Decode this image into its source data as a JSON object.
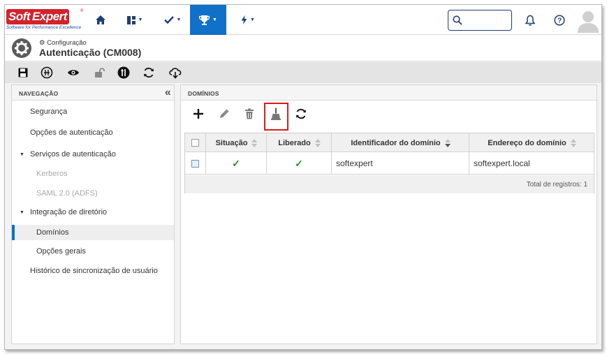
{
  "brand": {
    "soft": "Soft",
    "expert": "Expert",
    "reg": "®",
    "tagline": "Software for Performance Excellence",
    "color": "#d3222a"
  },
  "topnav": {
    "items": [
      {
        "icon": "home-icon"
      },
      {
        "icon": "dashboard-icon",
        "caret": "▼"
      },
      {
        "icon": "checkmark-icon",
        "caret": "▼"
      },
      {
        "icon": "trophy-icon",
        "caret": "▼",
        "active": true
      },
      {
        "icon": "bolt-icon",
        "caret": "▼"
      }
    ],
    "search_placeholder": "",
    "accent": "#1170c8"
  },
  "header": {
    "section": "Configuração",
    "title": "Autenticação (CM008)"
  },
  "toolbar": {
    "icons": [
      "save-icon",
      "history-icon",
      "view-icon",
      "unlock-icon",
      "info-icon",
      "refresh-icon",
      "cloud-download-icon"
    ]
  },
  "navigation": {
    "heading": "NAVEGAÇÃO",
    "collapse_glyph": "«",
    "items": [
      {
        "label": "Segurança"
      },
      {
        "label": "Opções de autenticação"
      },
      {
        "label": "Serviços de autenticação",
        "expander": "▼"
      },
      {
        "label": "Kerberos",
        "disabled": true
      },
      {
        "label": "SAML 2.0 (ADFS)",
        "disabled": true
      },
      {
        "label": "Integração de diretório",
        "expander": "▼"
      },
      {
        "label": "Domínios",
        "selected": true
      },
      {
        "label": "Opções gerais"
      },
      {
        "label": "Histórico de sincronização de usuário"
      }
    ]
  },
  "domains": {
    "heading": "DOMÍNIOS",
    "actions": [
      "add-icon",
      "edit-icon",
      "delete-icon",
      "clean-icon",
      "refresh-icon"
    ],
    "columns": [
      "Situação",
      "Liberado",
      "Identificador do domínio",
      "Endereço do domínio"
    ],
    "rows": [
      {
        "situacao": "✓",
        "liberado": "✓",
        "identificador": "softexpert",
        "endereco": "softexpert.local"
      }
    ],
    "footer": "Total de registros: 1",
    "check_color": "#2e8b2e",
    "highlight_color": "#d91c1c"
  }
}
